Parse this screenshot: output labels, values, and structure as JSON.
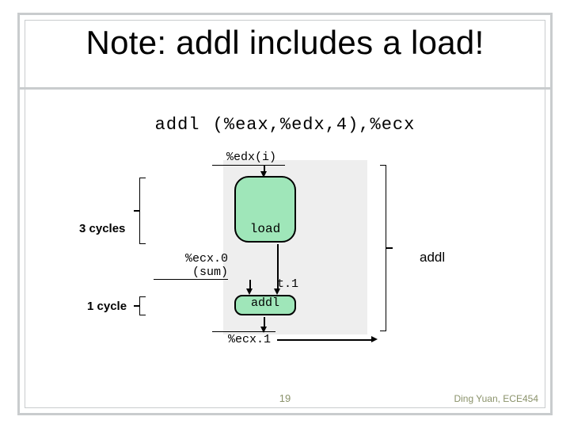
{
  "title": "Note: addl includes a load!",
  "code": "addl (%eax,%edx,4),%ecx",
  "labels": {
    "edx_i": "%edx(i)",
    "load": "load",
    "ecx0_line1": "%ecx.0",
    "ecx0_line2": "(sum)",
    "t1": "t.1",
    "addl_small": "addl",
    "ecx1": "%ecx.1",
    "cycles3": "3 cycles",
    "cycles1": "1 cycle",
    "addl_big": "addl"
  },
  "footer": {
    "page": "19",
    "credit": "Ding Yuan, ECE454"
  }
}
